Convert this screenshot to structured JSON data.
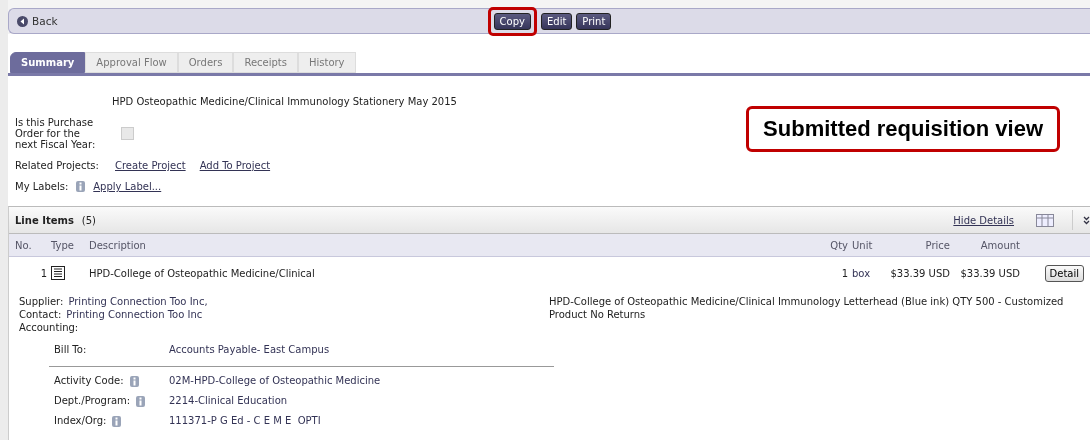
{
  "toolbar": {
    "back": "Back",
    "buttons": [
      {
        "label": "Copy",
        "highlighted": true
      },
      {
        "label": "Edit",
        "highlighted": false
      },
      {
        "label": "Print",
        "highlighted": false
      }
    ]
  },
  "tabs": [
    {
      "label": "Summary",
      "selected": true
    },
    {
      "label": "Approval Flow",
      "selected": false
    },
    {
      "label": "Orders",
      "selected": false
    },
    {
      "label": "Receipts",
      "selected": false
    },
    {
      "label": "History",
      "selected": false
    }
  ],
  "summary": {
    "title": "HPD Osteopathic Medicine/Clinical Immunology Stationery May 2015",
    "fiscal_label": "Is this Purchase Order for the next Fiscal Year:",
    "fiscal_checked": false,
    "projects_label": "Related Projects:",
    "project_links": [
      "Create Project",
      "Add To Project"
    ],
    "labels_label": "My Labels:",
    "labels_link": "Apply Label..."
  },
  "callout": "Submitted requisition view",
  "line_items": {
    "title": "Line Items",
    "count": "(5)",
    "hide_details": "Hide Details",
    "columns": [
      "No.",
      "Type",
      "Description",
      "Qty",
      "Unit",
      "Price",
      "Amount"
    ],
    "item": {
      "no": "1",
      "description": "HPD-College of Osteopathic Medicine/Clinical",
      "qty": "1",
      "unit": "box",
      "price": "$33.39 USD",
      "amount": "$33.39 USD",
      "detail_button": "Detail",
      "supplier_label": "Supplier:",
      "supplier": "Printing Connection Too Inc,",
      "contact_label": "Contact:",
      "contact": "Printing Connection Too Inc",
      "accounting_label": "Accounting:",
      "long_description": "HPD-College of Osteopathic Medicine/Clinical Immunology Letterhead (Blue ink) QTY 500 - Customized Product No Returns",
      "bill_to": {
        "label": "Bill To:",
        "value": "Accounts Payable- East Campus"
      },
      "accounting": [
        {
          "label": "Activity Code:",
          "value": "02M-HPD-College of Osteopathic Medicine"
        },
        {
          "label": "Dept./Program:",
          "value": "2214-Clinical Education"
        },
        {
          "label": "Index/Org:",
          "value": "111371-P G Ed - C E M E  OPTI"
        }
      ]
    }
  }
}
